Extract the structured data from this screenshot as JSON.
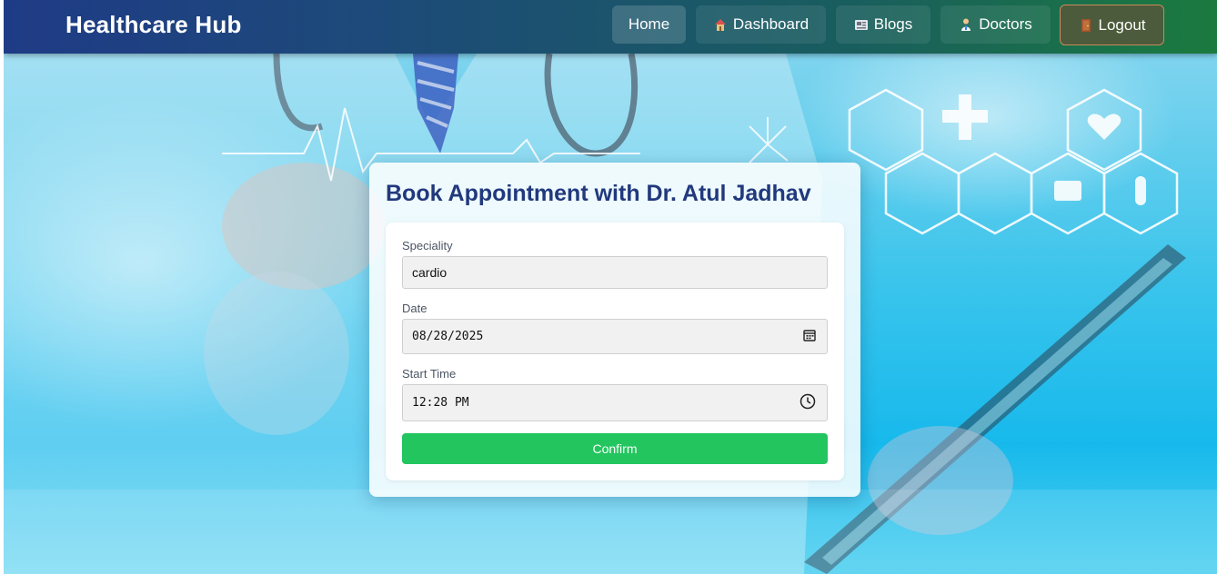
{
  "nav": {
    "brand": "Healthcare Hub",
    "items": [
      {
        "label": "Home",
        "icon": "none"
      },
      {
        "label": "Dashboard",
        "icon": "house-icon"
      },
      {
        "label": "Blogs",
        "icon": "newspaper-icon"
      },
      {
        "label": "Doctors",
        "icon": "doctor-icon"
      },
      {
        "label": "Logout",
        "icon": "door-icon"
      }
    ]
  },
  "appointment": {
    "title": "Book Appointment with Dr. Atul Jadhav",
    "speciality_label": "Speciality",
    "speciality_value": "cardio",
    "date_label": "Date",
    "date_value": "08/28/2025",
    "time_label": "Start Time",
    "time_value": "12:28 PM",
    "confirm_label": "Confirm"
  },
  "colors": {
    "confirm_button": "#22c55e",
    "title_text": "#21397d",
    "nav_gradient_start": "#1f3b86",
    "nav_gradient_end": "#1b7a3e"
  }
}
